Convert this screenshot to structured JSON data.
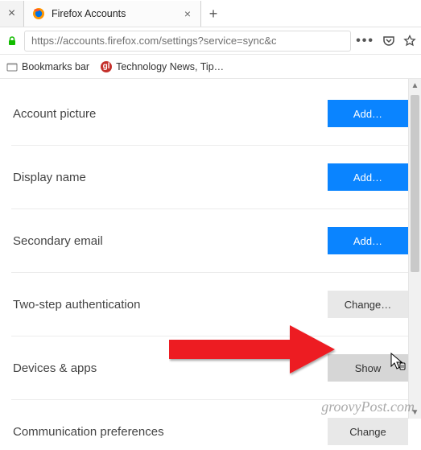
{
  "tab": {
    "title": "Firefox Accounts"
  },
  "url": "https://accounts.firefox.com/settings?service=sync&c",
  "bookmarks_bar": {
    "item1": "Bookmarks bar",
    "item2": "Technology News, Tip…"
  },
  "settings": {
    "rows": [
      {
        "label": "Account picture",
        "button": "Add…",
        "style": "primary"
      },
      {
        "label": "Display name",
        "button": "Add…",
        "style": "primary"
      },
      {
        "label": "Secondary email",
        "button": "Add…",
        "style": "primary"
      },
      {
        "label": "Two-step authentication",
        "button": "Change…",
        "style": "secondary"
      },
      {
        "label": "Devices & apps",
        "button": "Show",
        "style": "secondary-active"
      },
      {
        "label": "Communication preferences",
        "button": "Change",
        "style": "secondary"
      }
    ]
  },
  "watermark": "groovyPost.com"
}
